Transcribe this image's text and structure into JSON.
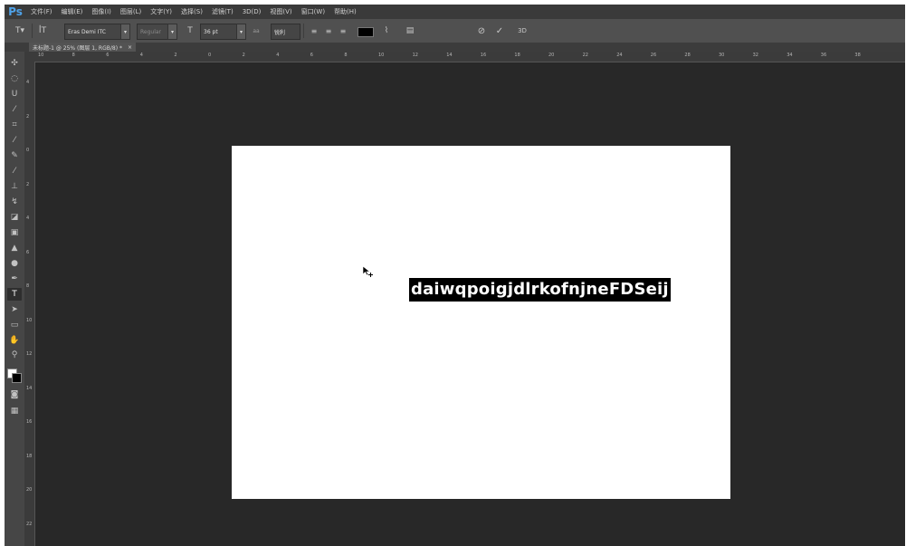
{
  "app": {
    "logo": "Ps"
  },
  "menubar": [
    "文件(F)",
    "编辑(E)",
    "图像(I)",
    "图层(L)",
    "文字(Y)",
    "选择(S)",
    "滤镜(T)",
    "3D(D)",
    "视图(V)",
    "窗口(W)",
    "帮助(H)"
  ],
  "options": {
    "tool_icon": "type-tool-icon",
    "font_family": "Eras Demi ITC",
    "font_style": "Regular",
    "font_size": "36 pt",
    "antialias_label": "aa",
    "antialias": "锐利",
    "text_color": "#000000",
    "mode_3d": "3D"
  },
  "document_tab": {
    "title": "未标题-1 @ 25% (图层 1, RGB/8) *",
    "close": "×"
  },
  "ruler": {
    "horizontal": [
      "10",
      "8",
      "6",
      "4",
      "2",
      "0",
      "2",
      "4",
      "6",
      "8",
      "10",
      "12",
      "14",
      "16",
      "18",
      "20",
      "22",
      "24",
      "26",
      "28",
      "30",
      "32",
      "34",
      "36",
      "38"
    ],
    "vertical": [
      "4",
      "2",
      "0",
      "2",
      "4",
      "6",
      "8",
      "10",
      "12",
      "14",
      "16",
      "18",
      "20",
      "22"
    ]
  },
  "canvas": {
    "background": "#ffffff",
    "text": "daiwqpoigjdlrkofnjneFDSeij",
    "selection_color": "#000000"
  },
  "toolbar": {
    "tools": [
      "move-tool-icon",
      "marquee-tool-icon",
      "lasso-tool-icon",
      "quick-select-tool-icon",
      "crop-tool-icon",
      "eyedropper-tool-icon",
      "healing-brush-tool-icon",
      "brush-tool-icon",
      "clone-stamp-tool-icon",
      "history-brush-tool-icon",
      "eraser-tool-icon",
      "gradient-tool-icon",
      "blur-tool-icon",
      "dodge-tool-icon",
      "pen-tool-icon",
      "type-tool-icon",
      "path-select-tool-icon",
      "shape-tool-icon",
      "hand-tool-icon",
      "zoom-tool-icon"
    ],
    "foreground": "#ffffff",
    "background": "#000000"
  }
}
